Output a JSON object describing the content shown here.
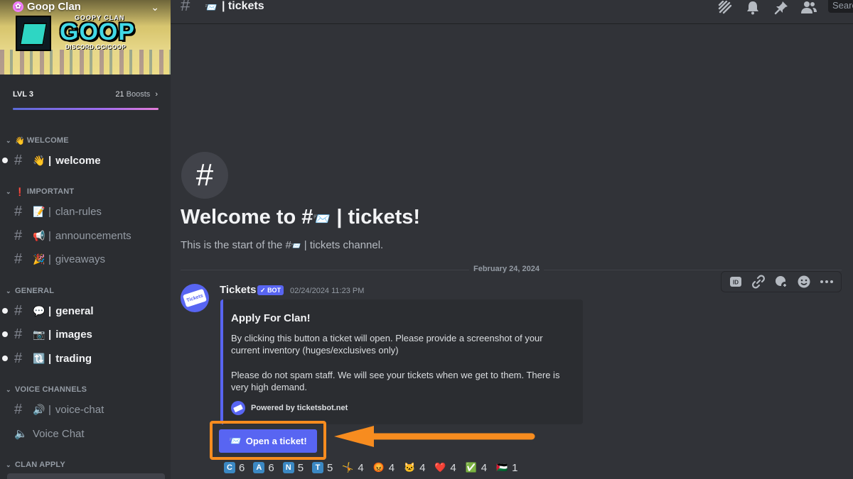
{
  "server": {
    "name": "Goop Clan",
    "banner_small": "GOOPY CLAN",
    "banner_big": "GOOP",
    "banner_invite": "DISCORD.GG/GOOP"
  },
  "boost": {
    "level": "LVL 3",
    "count": "21",
    "count_label": "Boosts",
    "progress": 1.0
  },
  "categories": {
    "welcome": {
      "label": "WELCOME",
      "emoji": "👋"
    },
    "important": {
      "label": "IMPORTANT",
      "emoji": "❗"
    },
    "general": {
      "label": "GENERAL"
    },
    "voice": {
      "label": "VOICE CHANNELS"
    },
    "clan_apply": {
      "label": "CLAN APPLY"
    }
  },
  "channels": [
    {
      "name": "welcome",
      "emoji": "👋",
      "unread": true
    },
    {
      "name": "clan-rules",
      "emoji": "📝",
      "unread": false
    },
    {
      "name": "announcements",
      "emoji": "📢",
      "unread": false
    },
    {
      "name": "giveaways",
      "emoji": "🎉",
      "unread": false
    },
    {
      "name": "general",
      "emoji": "💬",
      "unread": true
    },
    {
      "name": "images",
      "emoji": "📷",
      "unread": true
    },
    {
      "name": "trading",
      "emoji": "🔃",
      "unread": true
    },
    {
      "name": "voice-chat",
      "emoji": "🔊",
      "unread": false
    },
    {
      "name": "Voice Chat",
      "emoji": "🔊",
      "unread": false
    }
  ],
  "header": {
    "channel_emoji": "📨",
    "channel_title": "| tickets",
    "search_placeholder": "Search"
  },
  "intro": {
    "title_prefix": "Welcome to #",
    "title_emoji": "📨",
    "title_suffix": " | tickets!",
    "sub_prefix": "This is the start of the #",
    "sub_emoji": "📨",
    "sub_suffix": " | tickets channel."
  },
  "divider_date": "February 24, 2024",
  "message": {
    "author": "Tickets",
    "bot_tag": "BOT",
    "timestamp": "02/24/2024 11:23 PM",
    "avatar_text": "Tickets",
    "embed": {
      "title": "Apply For Clan!",
      "desc1": "By clicking this button a ticket will open. Please provide a screenshot of your current inventory (huges/exclusives only)",
      "desc2": "Please do not spam staff. We will see your tickets when we get to them. There is very high demand.",
      "footer": "Powered by ticketsbot.net"
    },
    "button": {
      "emoji": "📨",
      "label": "Open a ticket!"
    }
  },
  "reactions": [
    {
      "type": "letter",
      "glyph": "C",
      "count": "6"
    },
    {
      "type": "letter",
      "glyph": "A",
      "count": "6"
    },
    {
      "type": "letter",
      "glyph": "N",
      "count": "5"
    },
    {
      "type": "letter",
      "glyph": "T",
      "count": "5"
    },
    {
      "type": "emoji",
      "glyph": "🤸",
      "count": "4"
    },
    {
      "type": "emoji",
      "glyph": "😡",
      "count": "4"
    },
    {
      "type": "emoji",
      "glyph": "🐱",
      "count": "4"
    },
    {
      "type": "emoji",
      "glyph": "❤️",
      "count": "4"
    },
    {
      "type": "emoji",
      "glyph": "✅",
      "count": "4"
    },
    {
      "type": "emoji",
      "glyph": "🇵🇸",
      "count": "1"
    }
  ],
  "colors": {
    "accent": "#5865f2",
    "highlight": "#f78c1f",
    "background": "#313338",
    "sidebar": "#2b2d31"
  },
  "icons": [
    "threads-icon",
    "bell-icon",
    "pin-icon",
    "members-icon",
    "app-id-icon",
    "link-icon",
    "reply-icon",
    "emoji-icon",
    "more-icon"
  ]
}
